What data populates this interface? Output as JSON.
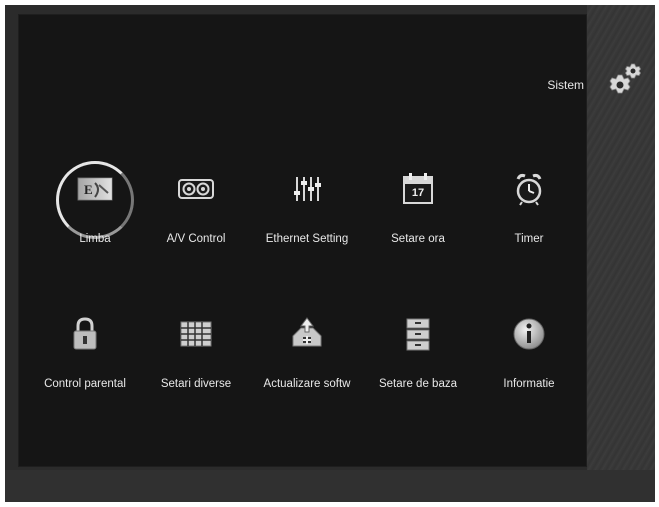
{
  "header": {
    "title": "Sistem",
    "icon": "gears-icon"
  },
  "menu": {
    "selected_index": 0,
    "items": [
      {
        "label": "Limba",
        "icon": "language-flag-icon"
      },
      {
        "label": "A/V Control",
        "icon": "av-connector-icon"
      },
      {
        "label": "Ethernet Setting",
        "icon": "equalizer-sliders-icon"
      },
      {
        "label": "Setare ora",
        "icon": "calendar-icon",
        "icon_text": "17"
      },
      {
        "label": "Timer",
        "icon": "alarm-clock-icon"
      },
      {
        "label": "Control parental",
        "icon": "padlock-icon"
      },
      {
        "label": "Setari diverse",
        "icon": "grid-panel-icon"
      },
      {
        "label": "Actualizare softw",
        "icon": "software-upgrade-icon"
      },
      {
        "label": "Setare de baza",
        "icon": "storage-drawers-icon"
      },
      {
        "label": "Informatie",
        "icon": "info-disc-icon"
      }
    ]
  }
}
